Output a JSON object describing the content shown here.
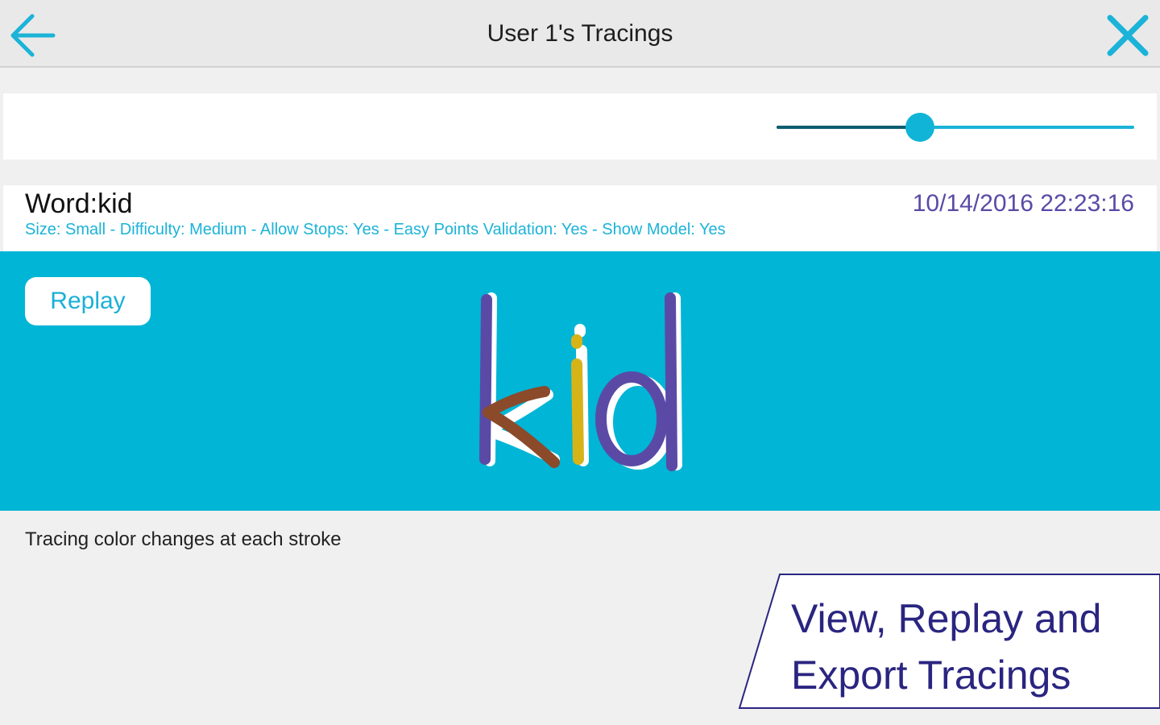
{
  "header": {
    "title": "User 1's Tracings",
    "back_icon": "arrow-left-icon",
    "close_icon": "close-icon"
  },
  "slider": {
    "value_fraction": 0.4
  },
  "tracing": {
    "word_label": "Word:kid",
    "settings": "Size: Small - Difficulty: Medium - Allow Stops: Yes - Easy Points Validation: Yes - Show Model: Yes",
    "timestamp": "10/14/2016 22:23:16",
    "replay_label": "Replay",
    "caption": "Tracing color changes at each stroke"
  },
  "promo": {
    "line1": "View, Replay and",
    "line2": "Export Tracings"
  },
  "colors": {
    "accent": "#1bb3d8",
    "canvas_bg": "#00b5d5",
    "stroke_purple": "#5a4aa6",
    "stroke_brown": "#8b4a2a",
    "stroke_yellow": "#d6b418",
    "timestamp": "#5a4aa6",
    "promo_text": "#2a2580"
  }
}
